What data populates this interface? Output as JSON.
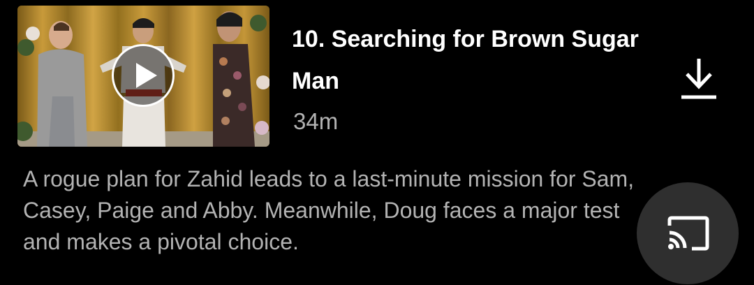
{
  "episode": {
    "title": "10. Searching for Brown Sugar Man",
    "duration": "34m",
    "synopsis": "A rogue plan for Zahid leads to a last-minute mission for Sam, Casey, Paige and Abby. Meanwhile, Doug faces a major test and makes a pivotal choice."
  },
  "icons": {
    "play": "play-icon",
    "download": "download-icon",
    "cast": "cast-icon"
  },
  "colors": {
    "background": "#000000",
    "title": "#ffffff",
    "secondary_text": "#b3b3b3",
    "cast_button_bg": "#2f2f2f"
  }
}
